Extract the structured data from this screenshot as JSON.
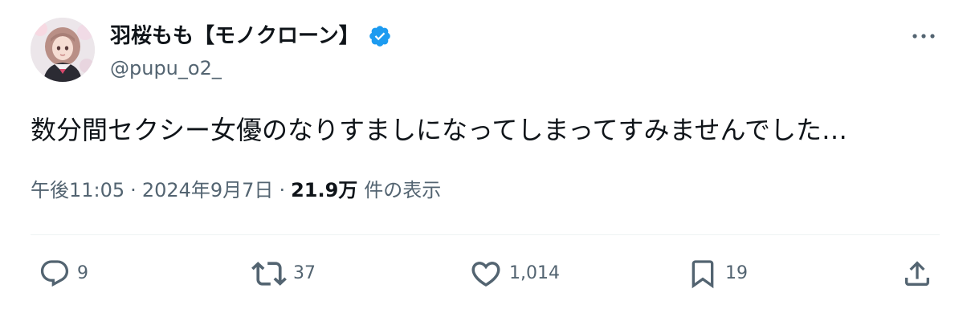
{
  "author": {
    "display_name": "羽桜もも【モノクローン】",
    "handle": "@pupu_o2_",
    "verified": true,
    "verified_badge_color": "#1d9bf0"
  },
  "tweet": {
    "text": "数分間セクシー女優のなりすましになってしまってすみませんでした…",
    "time": "午後11:05",
    "date": "2024年9月7日",
    "separator": "·",
    "views_count": "21.9万",
    "views_label": "件の表示"
  },
  "actions": {
    "reply": {
      "icon": "reply-icon",
      "count": "9"
    },
    "retweet": {
      "icon": "retweet-icon",
      "count": "37"
    },
    "like": {
      "icon": "heart-icon",
      "count": "1,014"
    },
    "bookmark": {
      "icon": "bookmark-icon",
      "count": "19"
    },
    "share": {
      "icon": "share-icon"
    }
  },
  "colors": {
    "text_primary": "#0f1419",
    "text_secondary": "#536471",
    "divider": "#eff3f4"
  }
}
